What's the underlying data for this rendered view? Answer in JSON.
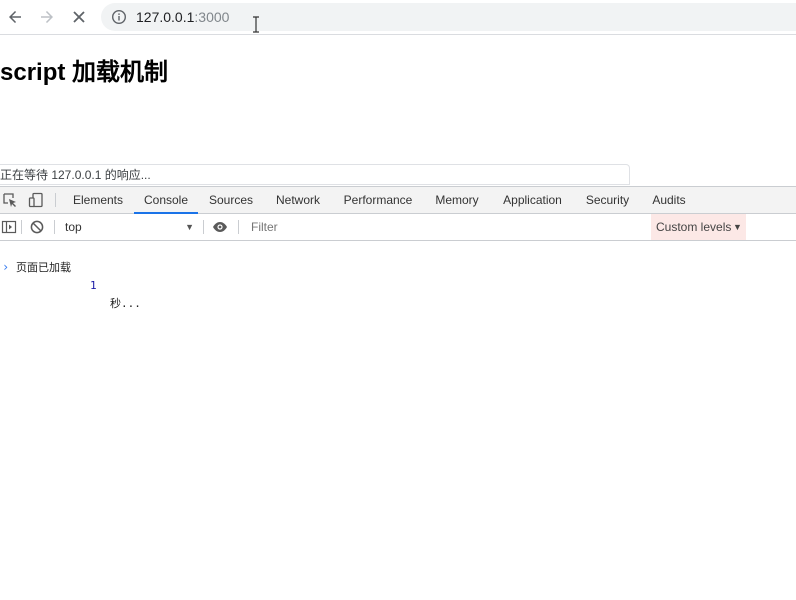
{
  "browser": {
    "url_host": "127.0.0.1",
    "url_port": ":3000",
    "icons": [
      "back-arrow-icon",
      "forward-arrow-icon",
      "stop-loading-icon",
      "site-info-icon",
      "text-cursor-icon"
    ]
  },
  "page": {
    "title": "script 加载机制",
    "status_text": "正在等待 127.0.0.1 的响应..."
  },
  "devtools": {
    "tabs": [
      {
        "label": "Elements",
        "active": false
      },
      {
        "label": "Console",
        "active": true
      },
      {
        "label": "Sources",
        "active": false
      },
      {
        "label": "Network",
        "active": false
      },
      {
        "label": "Performance",
        "active": false
      },
      {
        "label": "Memory",
        "active": false
      },
      {
        "label": "Application",
        "active": false
      },
      {
        "label": "Security",
        "active": false
      },
      {
        "label": "Audits",
        "active": false
      }
    ],
    "console_toolbar": {
      "context": "top",
      "filter_placeholder": "Filter",
      "levels_label": "Custom levels"
    },
    "messages": [
      {
        "text_a": "页面已加载",
        "number": "1",
        "text_b": "秒..."
      }
    ]
  },
  "colors": {
    "accent": "#1a73e8",
    "levels_bg": "#fce8e6",
    "prompt": "#367cf1",
    "number": "#1a1aa6"
  }
}
